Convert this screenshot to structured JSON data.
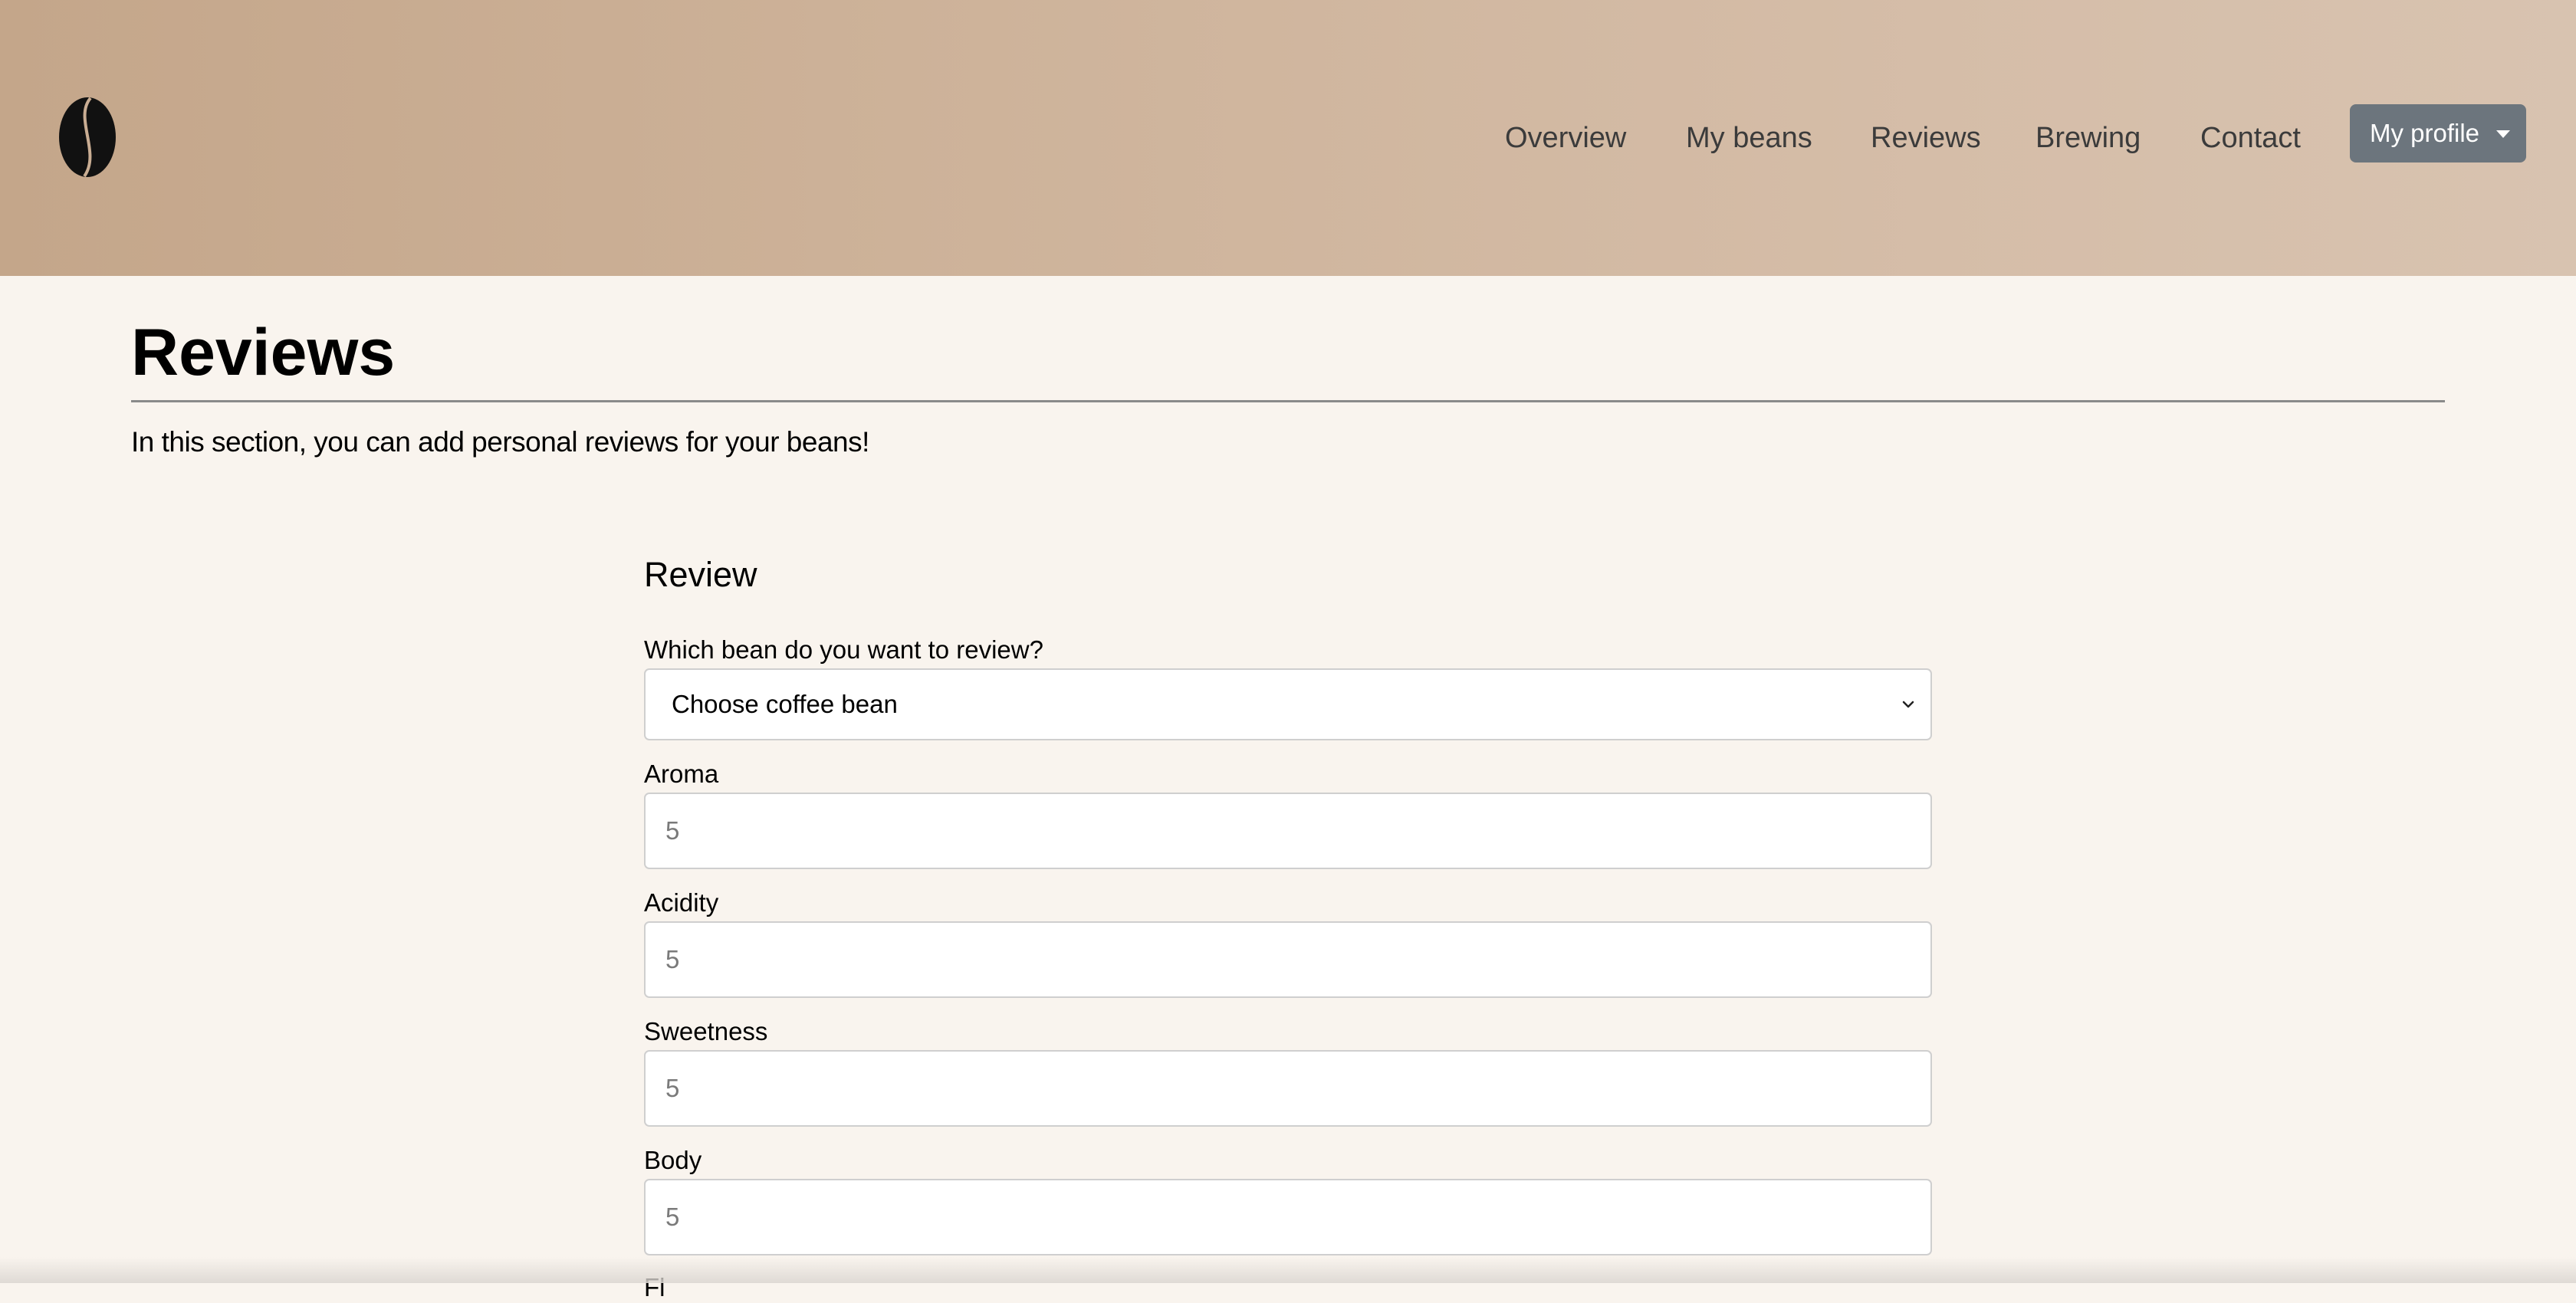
{
  "nav": {
    "items": [
      {
        "label": "Overview"
      },
      {
        "label": "My beans"
      },
      {
        "label": "Reviews"
      },
      {
        "label": "Brewing"
      },
      {
        "label": "Contact"
      }
    ],
    "profile_label": "My profile"
  },
  "page": {
    "title": "Reviews",
    "intro": "In this section, you can add personal reviews for your beans!"
  },
  "form": {
    "title": "Review",
    "bean_label": "Which bean do you want to review?",
    "bean_select_value": "Choose coffee bean",
    "fields": [
      {
        "label": "Aroma",
        "placeholder": "5"
      },
      {
        "label": "Acidity",
        "placeholder": "5"
      },
      {
        "label": "Sweetness",
        "placeholder": "5"
      },
      {
        "label": "Body",
        "placeholder": "5"
      }
    ],
    "next_label_partial": "Fl"
  },
  "colors": {
    "header_start": "#c4a68a",
    "header_end": "#d8c3b0",
    "background": "#f9f4ee",
    "profile_button": "#6c757d"
  },
  "icons": {
    "logo": "coffee-bean-icon",
    "profile_caret": "caret-down-icon",
    "select_chevron": "chevron-down-icon"
  }
}
